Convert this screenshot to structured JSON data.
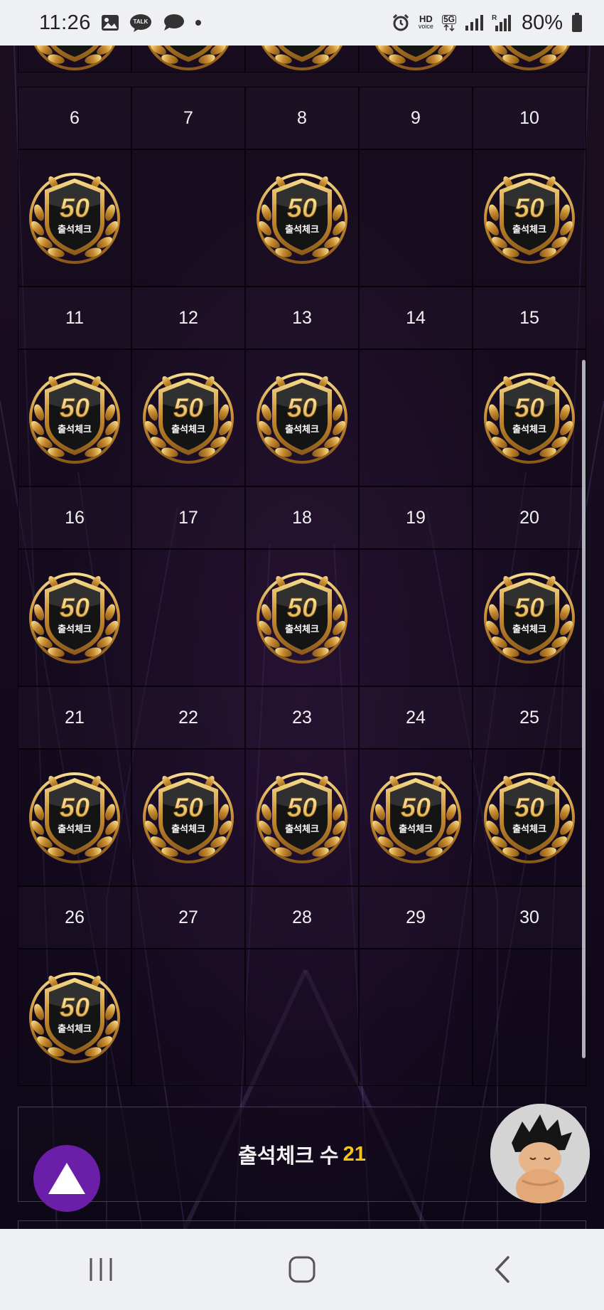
{
  "status_bar": {
    "time": "11:26",
    "notif_icons": [
      "gallery-icon",
      "kakaotalk-icon",
      "chat-bubble-icon",
      "dot-icon"
    ],
    "talk_label": "TALK",
    "hd_label": "HD",
    "voice_label": "voice",
    "network_label": "5G",
    "battery": "80%"
  },
  "calendar": {
    "rows": [
      {
        "days": [
          "6",
          "7",
          "8",
          "9",
          "10"
        ],
        "checked": [
          true,
          false,
          true,
          false,
          true
        ]
      },
      {
        "days": [
          "11",
          "12",
          "13",
          "14",
          "15"
        ],
        "checked": [
          true,
          true,
          true,
          false,
          true
        ]
      },
      {
        "days": [
          "16",
          "17",
          "18",
          "19",
          "20"
        ],
        "checked": [
          true,
          false,
          true,
          false,
          true
        ]
      },
      {
        "days": [
          "21",
          "22",
          "23",
          "24",
          "25"
        ],
        "checked": [
          true,
          true,
          true,
          true,
          true
        ]
      },
      {
        "days": [
          "26",
          "27",
          "28",
          "29",
          "30"
        ],
        "checked": [
          true,
          false,
          false,
          false,
          false
        ]
      }
    ],
    "badge": {
      "number": "50",
      "label": "출석체크"
    }
  },
  "summary": {
    "label": "출석체크 수",
    "count": "21"
  },
  "colors": {
    "accent": "#f5c518",
    "button": "#6b1fa8",
    "badge_gold": "#d9a441"
  }
}
